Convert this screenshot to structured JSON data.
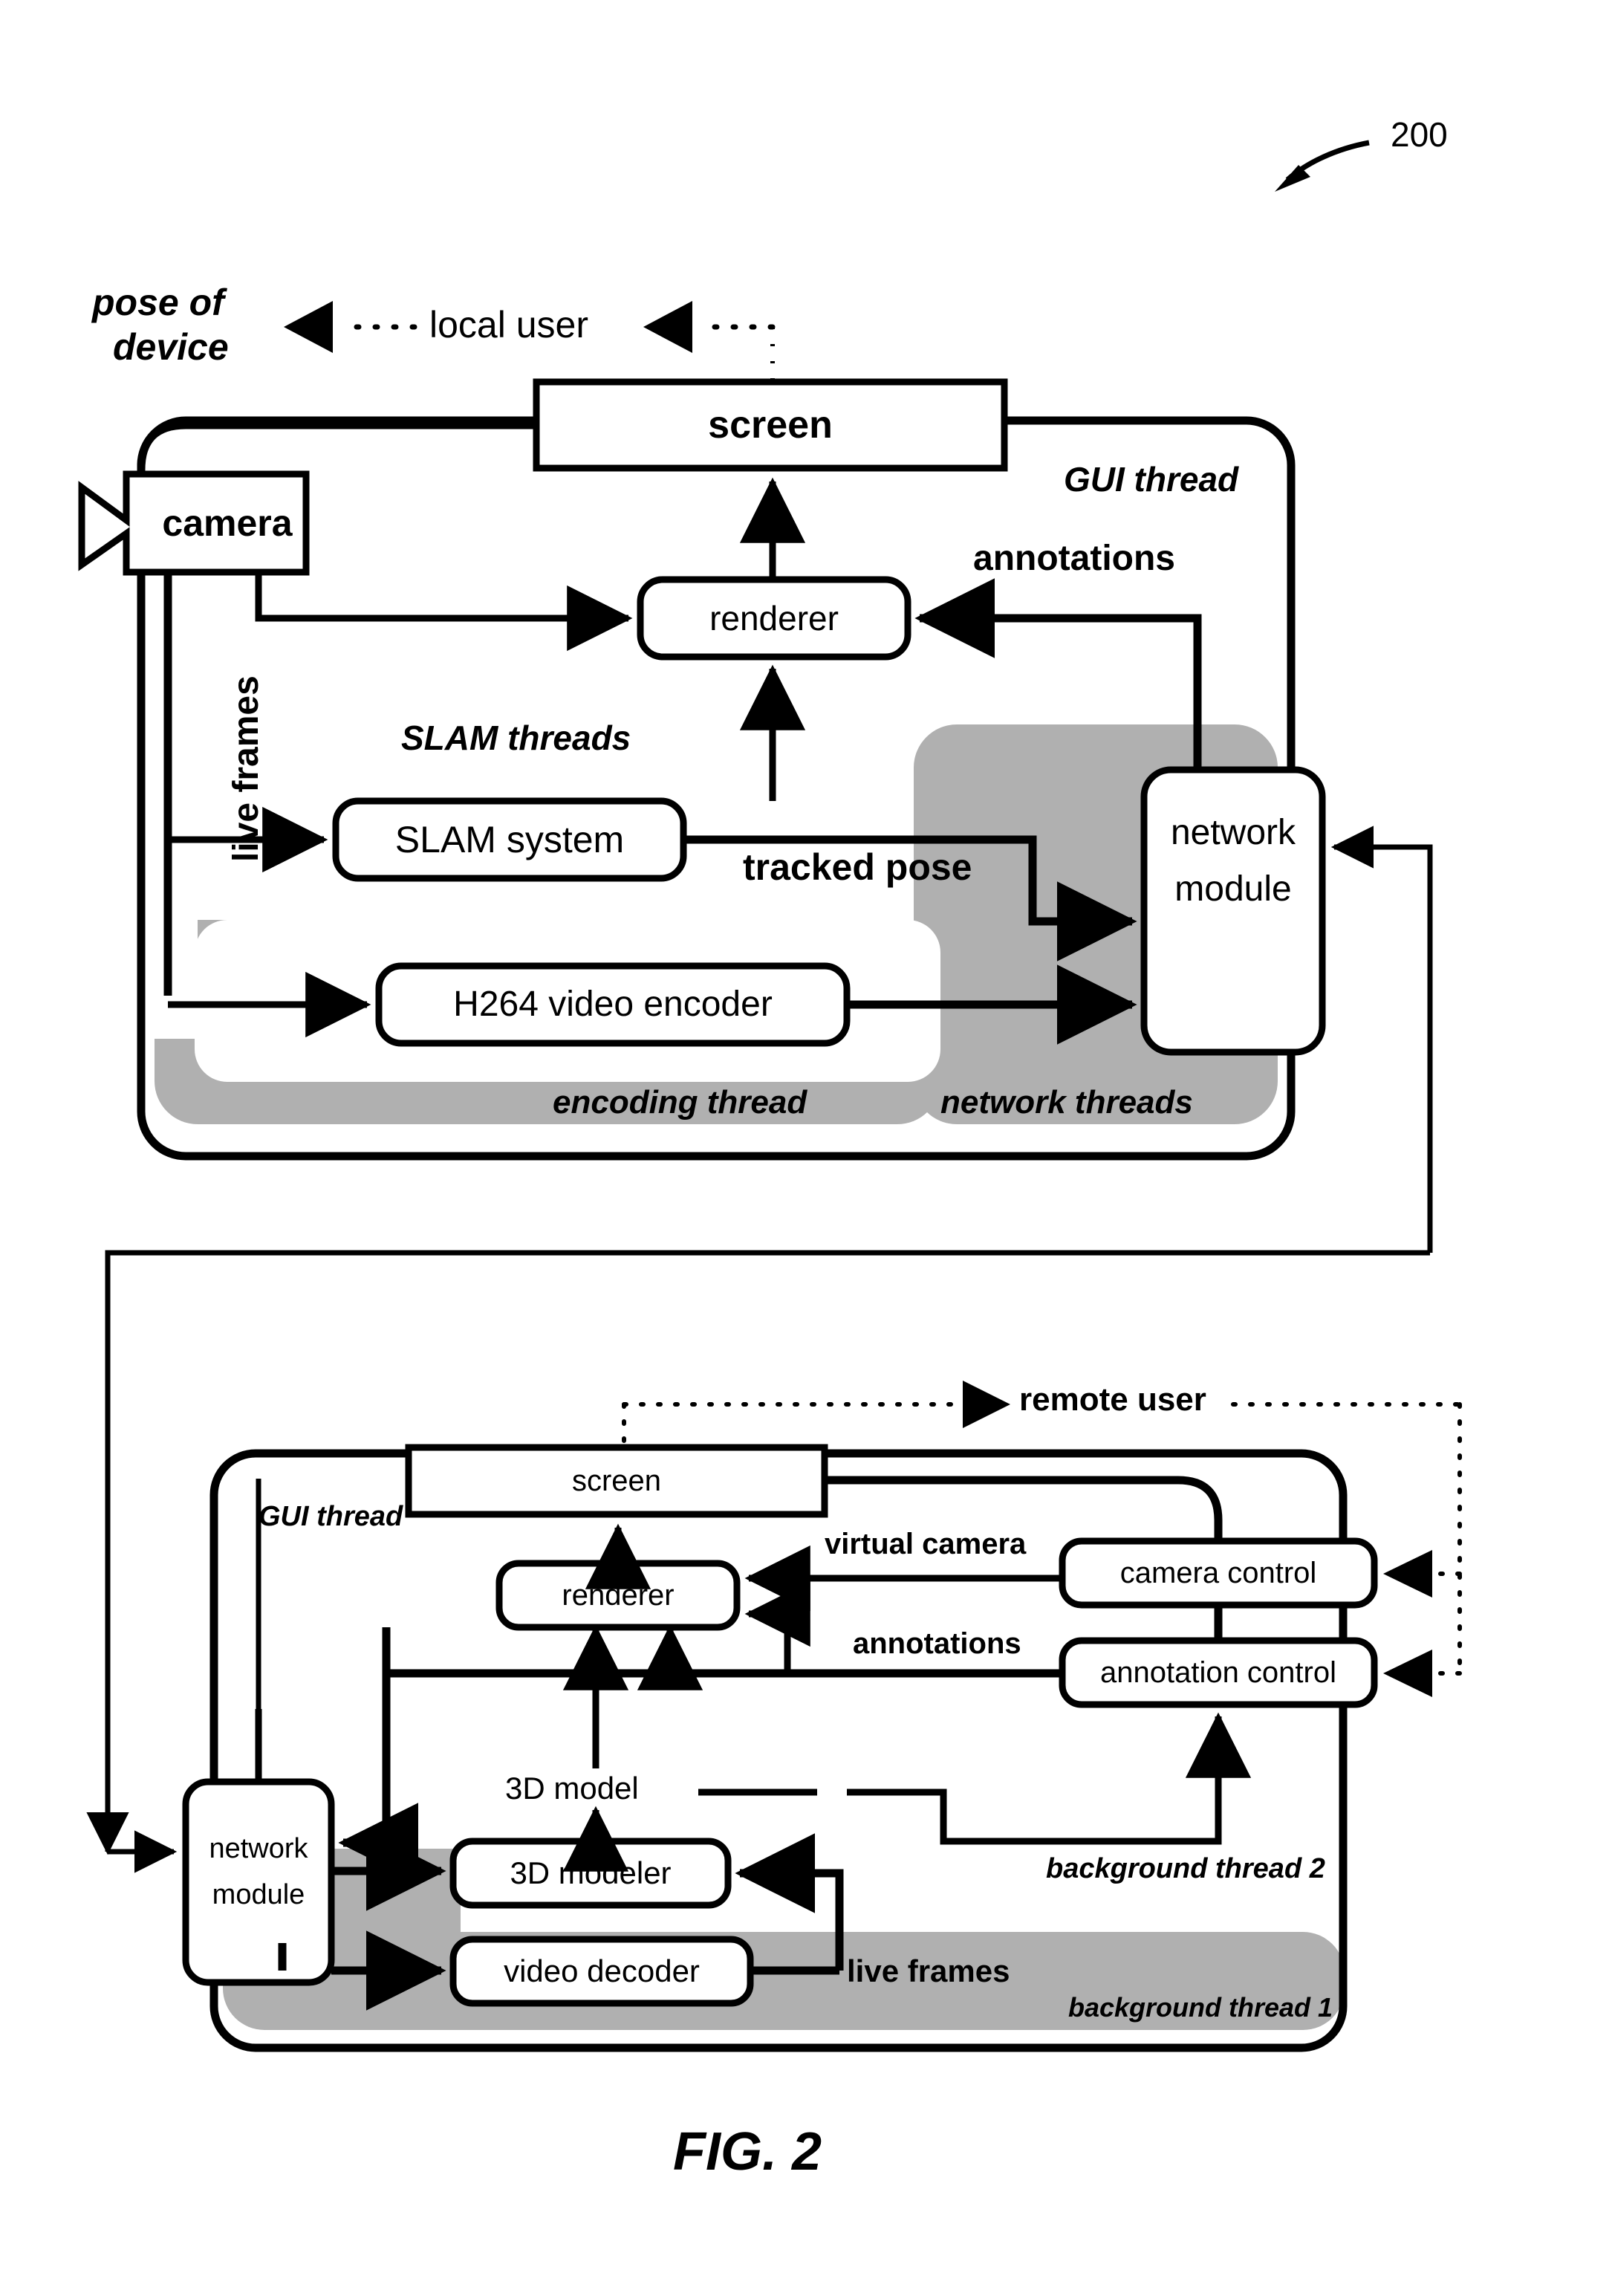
{
  "figure": {
    "caption": "FIG. 2",
    "reference_numeral": "200"
  },
  "local_device_panel": {
    "thread_label": "GUI thread",
    "sub_threads": [
      {
        "id": "slam",
        "label": "SLAM threads",
        "shaded": false
      },
      {
        "id": "encoding",
        "label": "encoding thread",
        "shaded": true
      },
      {
        "id": "network",
        "label": "network threads",
        "shaded": true
      }
    ],
    "nodes": [
      {
        "id": "camera",
        "label": "camera",
        "shape": "camera"
      },
      {
        "id": "screen",
        "label": "screen",
        "shape": "rect"
      },
      {
        "id": "renderer",
        "label": "renderer",
        "shape": "rounded"
      },
      {
        "id": "slam-system",
        "label": "SLAM system",
        "shape": "rounded"
      },
      {
        "id": "h264-encoder",
        "label": "H264 video encoder",
        "shape": "rounded"
      },
      {
        "id": "network-module",
        "label": "network\nmodule",
        "label_line1": "network",
        "label_line2": "module",
        "shape": "rounded"
      }
    ],
    "edge_labels": [
      {
        "id": "pose-of-device",
        "line1": "pose of",
        "line2": "device"
      },
      {
        "id": "local-user",
        "label": "local user"
      },
      {
        "id": "live-frames",
        "label": "live frames",
        "orientation": "vertical"
      },
      {
        "id": "annotations",
        "label": "annotations"
      },
      {
        "id": "tracked-pose",
        "label": "tracked pose"
      }
    ]
  },
  "remote_device_panel": {
    "thread_label": "GUI thread",
    "sub_threads": [
      {
        "id": "bg2",
        "label": "background thread 2",
        "shaded": false
      },
      {
        "id": "bg1",
        "label": "background thread 1",
        "shaded": true
      }
    ],
    "nodes": [
      {
        "id": "screen",
        "label": "screen",
        "shape": "rect"
      },
      {
        "id": "renderer",
        "label": "renderer",
        "shape": "rounded"
      },
      {
        "id": "camera-control",
        "label": "camera control",
        "shape": "rounded"
      },
      {
        "id": "annotation-control",
        "label": "annotation control",
        "shape": "rounded"
      },
      {
        "id": "network-module",
        "label_line1": "network",
        "label_line2": "module",
        "shape": "rounded"
      },
      {
        "id": "3d-modeler",
        "label": "3D modeler",
        "shape": "rounded"
      },
      {
        "id": "video-decoder",
        "label": "video decoder",
        "shape": "rounded"
      }
    ],
    "edge_labels": [
      {
        "id": "remote-user",
        "label": "remote user"
      },
      {
        "id": "virtual-camera",
        "label": "virtual camera"
      },
      {
        "id": "annotations",
        "label": "annotations"
      },
      {
        "id": "3d-model",
        "label": "3D model"
      },
      {
        "id": "live-frames",
        "label": "live frames"
      }
    ]
  },
  "colors": {
    "stroke": "#000000",
    "shade": "#b0b0b0",
    "background": "#ffffff"
  }
}
